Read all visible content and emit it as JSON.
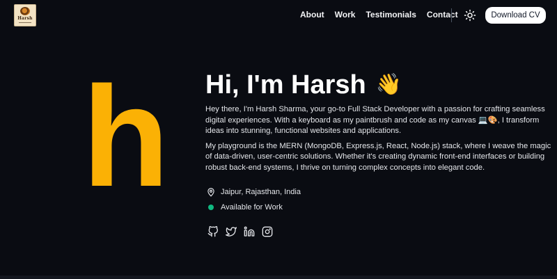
{
  "nav": {
    "logo_text": "Harsh",
    "links": [
      "About",
      "Work",
      "Testimonials",
      "Contact"
    ],
    "theme_icon": "sun-icon",
    "cta_label": "Download CV"
  },
  "hero": {
    "big_letter": "h",
    "big_letter_color": "#fbb105",
    "greeting": "Hi, I'm Harsh",
    "wave": "👋",
    "paragraph1": "Hey there, I'm Harsh Sharma, your go-to Full Stack Developer with a passion for crafting seamless digital experiences. With a keyboard as my paintbrush and code as my canvas 💻🎨, I transform ideas into stunning, functional websites and applications.",
    "paragraph2": "My playground is the MERN (MongoDB, Express.js, React, Node.js) stack, where I weave the magic of data-driven, user-centric solutions. Whether it's creating dynamic front-end interfaces or building robust back-end systems, I thrive on turning complex concepts into elegant code."
  },
  "meta": {
    "location": "Jaipur, Rajasthan, India",
    "availability": "Available for Work",
    "availability_color": "#10b981"
  },
  "socials": [
    "github-icon",
    "twitter-icon",
    "linkedin-icon",
    "instagram-icon"
  ]
}
